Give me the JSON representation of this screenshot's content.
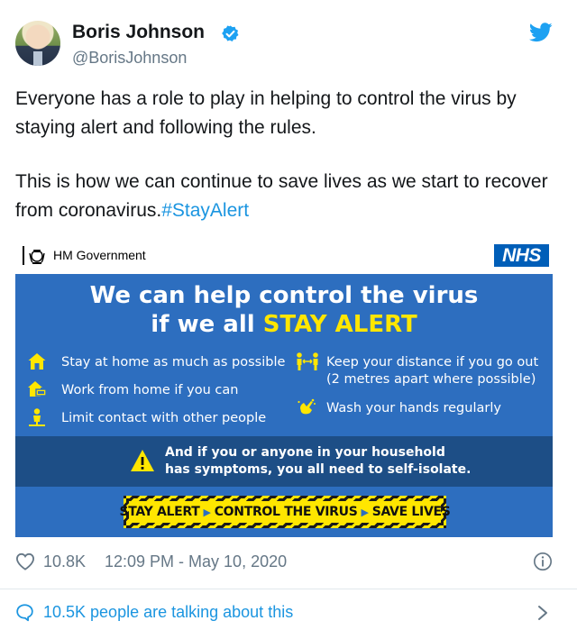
{
  "tweet": {
    "author_name": "Boris Johnson",
    "handle": "@BorisJohnson",
    "text_p1": "Everyone has a role to play in helping to control the virus by staying alert and following the rules.",
    "text_p2": "This is how we can continue to save lives as we start to recover from coronavirus.",
    "hashtag": "#StayAlert",
    "likes": "10.8K",
    "timestamp": "12:09 PM - May 10, 2020",
    "talking": "10.5K people are talking about this"
  },
  "poster": {
    "gov_label": "HM Government",
    "nhs_label": "NHS",
    "headline_line1": "We can help control the virus",
    "headline_line2_prefix": "if we all ",
    "headline_line2_emph": "STAY ALERT",
    "left_rules": [
      "Stay at home as much as possible",
      "Work from home if you can",
      "Limit contact with other people"
    ],
    "right_rule1_line1": "Keep your distance if you go out",
    "right_rule1_line2": "(2 metres apart where possible)",
    "right_rule2": "Wash your hands regularly",
    "warning_line1": "And if you or anyone in your household",
    "warning_line2": "has symptoms, you all need to self-isolate.",
    "slogan": [
      "STAY ALERT",
      "CONTROL THE VIRUS",
      "SAVE LIVES"
    ]
  },
  "colors": {
    "poster_blue": "#2d6ebf",
    "poster_dark": "#1d4e86",
    "alert_yellow": "#ffe600",
    "twitter_blue": "#1b95e0",
    "nhs_blue": "#005eb8"
  },
  "icons": [
    "verified-badge-icon",
    "twitter-bird-icon",
    "crest-icon",
    "house-icon",
    "work-home-icon",
    "person-icon",
    "distance-icon",
    "hand-wash-icon",
    "warning-icon",
    "heart-icon",
    "info-icon",
    "speech-bubble-icon",
    "chevron-right-icon"
  ]
}
